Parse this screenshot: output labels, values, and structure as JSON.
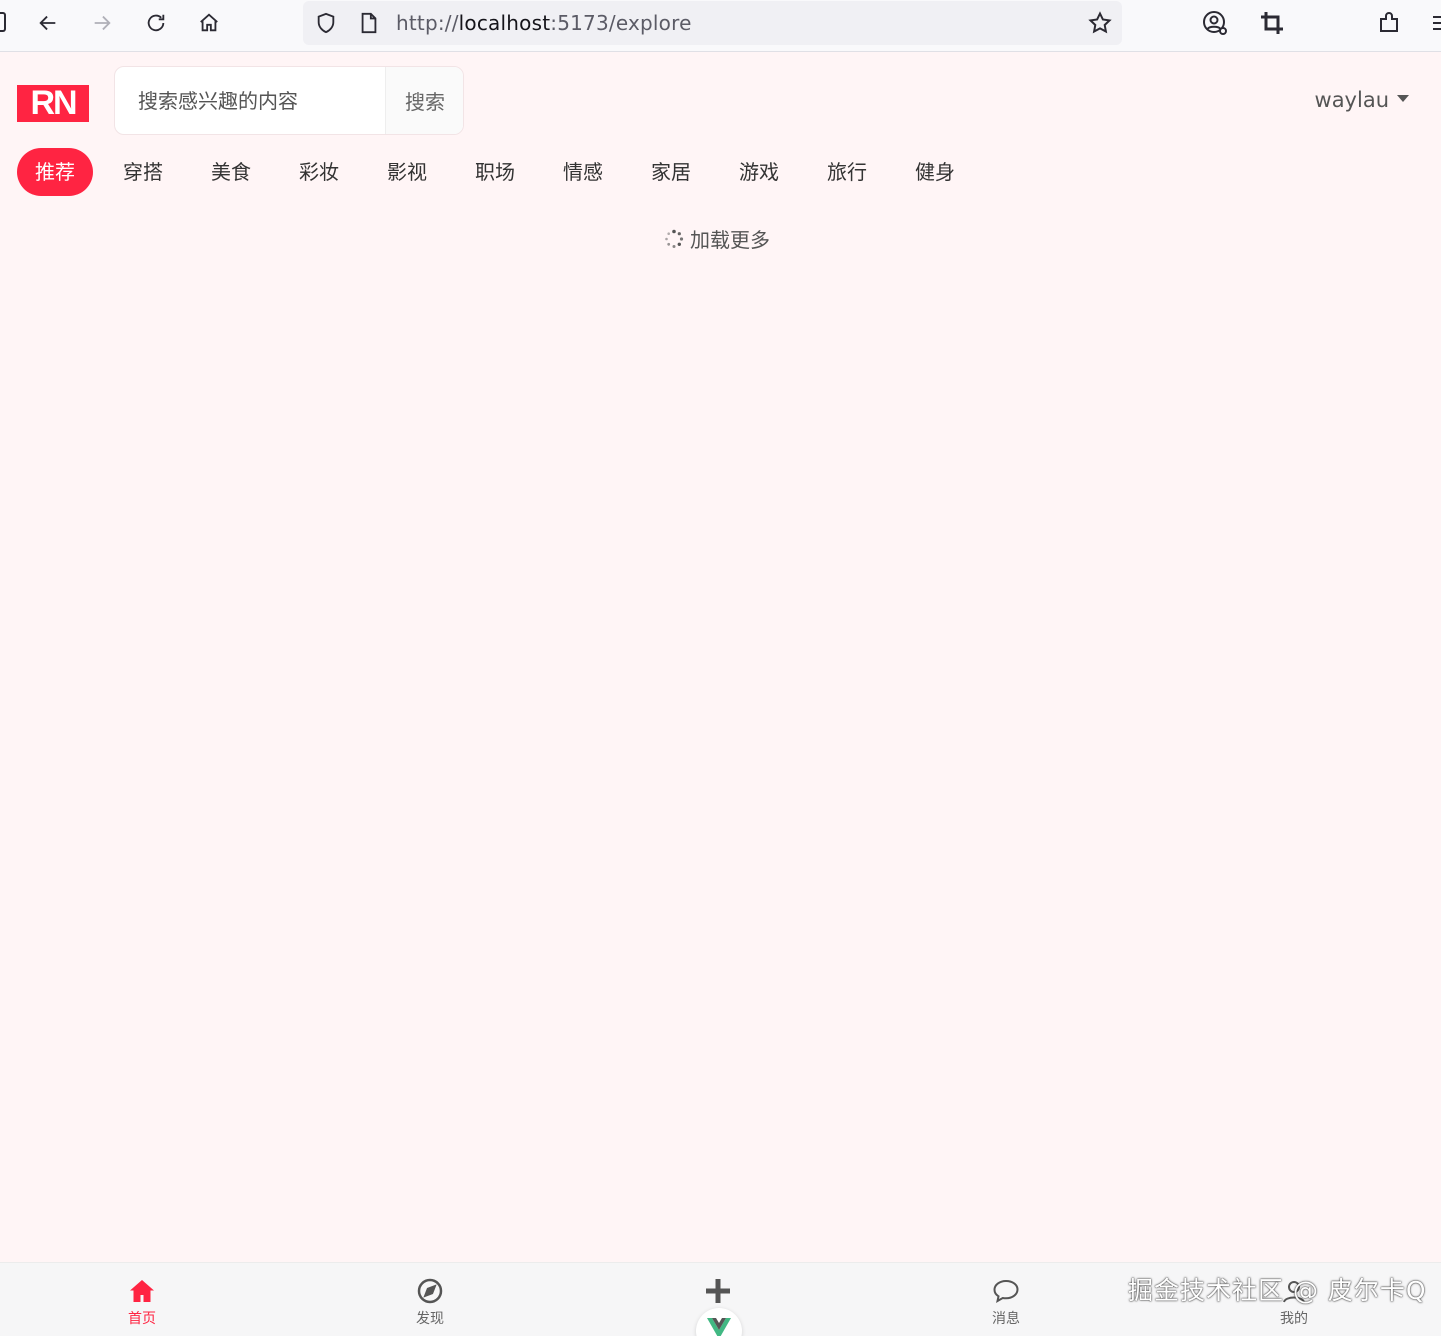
{
  "browser": {
    "url_scheme": "http://",
    "url_host": "localhost",
    "url_rest": ":5173/explore"
  },
  "header": {
    "logo_text": "RN",
    "search_placeholder": "搜索感兴趣的内容",
    "search_button": "搜索",
    "username": "waylau"
  },
  "tabs": [
    {
      "label": "推荐",
      "active": true
    },
    {
      "label": "穿搭"
    },
    {
      "label": "美食"
    },
    {
      "label": "彩妆"
    },
    {
      "label": "影视"
    },
    {
      "label": "职场"
    },
    {
      "label": "情感"
    },
    {
      "label": "家居"
    },
    {
      "label": "游戏"
    },
    {
      "label": "旅行"
    },
    {
      "label": "健身"
    }
  ],
  "loading_text": "加载更多",
  "bottom_nav": {
    "home": "首页",
    "discover": "发现",
    "messages": "消息",
    "me": "我的"
  },
  "watermark": "掘金技术社区 @ 皮尔卡Q",
  "colors": {
    "accent": "#ff2442",
    "background": "#fff5f6"
  }
}
